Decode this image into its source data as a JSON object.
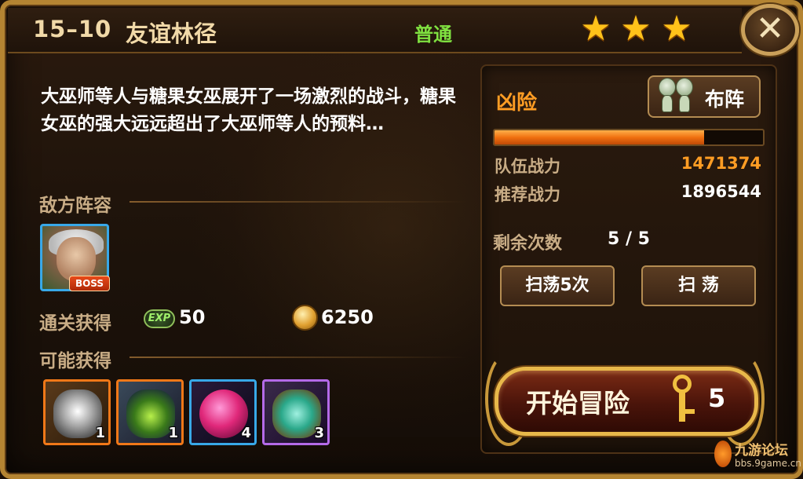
{
  "header": {
    "stage_code": "15–10",
    "stage_name": "友谊林径",
    "difficulty": "普通",
    "stars_earned": 3,
    "star_glyph": "★",
    "close_glyph": "✕"
  },
  "description": "大巫师等人与糖果女巫展开了一场激烈的战斗，糖果女巫的强大远远超出了大巫师等人的预料…",
  "enemy_section": {
    "label": "敌方阵容",
    "enemies": [
      {
        "badge": "BOSS",
        "icon": "witch-portrait-icon"
      }
    ]
  },
  "clear_rewards": {
    "label": "通关获得",
    "exp_icon_text": "EXP",
    "exp": "50",
    "gold": "6250"
  },
  "possible_drops": {
    "label": "可能获得",
    "items": [
      {
        "icon": "silver-dragon-armor-icon",
        "count": "1",
        "rarity_color": "#f07818"
      },
      {
        "icon": "green-cloak-icon",
        "count": "1",
        "rarity_color": "#f07818"
      },
      {
        "icon": "pink-crystal-orb-icon",
        "count": "4",
        "rarity_color": "#38a8e8"
      },
      {
        "icon": "potion-bottle-icon",
        "count": "3",
        "rarity_color": "#b46ae8"
      }
    ]
  },
  "battle_panel": {
    "danger_label": "凶险",
    "formation_label": "布阵",
    "power_ratio": 0.78,
    "team_power_label": "队伍战力",
    "team_power": "1471374",
    "recommended_power_label": "推荐战力",
    "recommended_power": "1896544",
    "remaining_label": "剩余次数",
    "remaining": "5 / 5",
    "sweep5_label": "扫荡5次",
    "sweep_label": "扫 荡",
    "start_label": "开始冒险",
    "key_cost": "5"
  },
  "watermark": {
    "title": "九游论坛",
    "url": "bbs.9game.cn"
  },
  "colors": {
    "gold_frame": "#b48432",
    "difficulty_green": "#7fe040",
    "danger_orange": "#ff9d24",
    "team_power_orange": "#ff9d24",
    "label_tan": "#c9ad86"
  }
}
